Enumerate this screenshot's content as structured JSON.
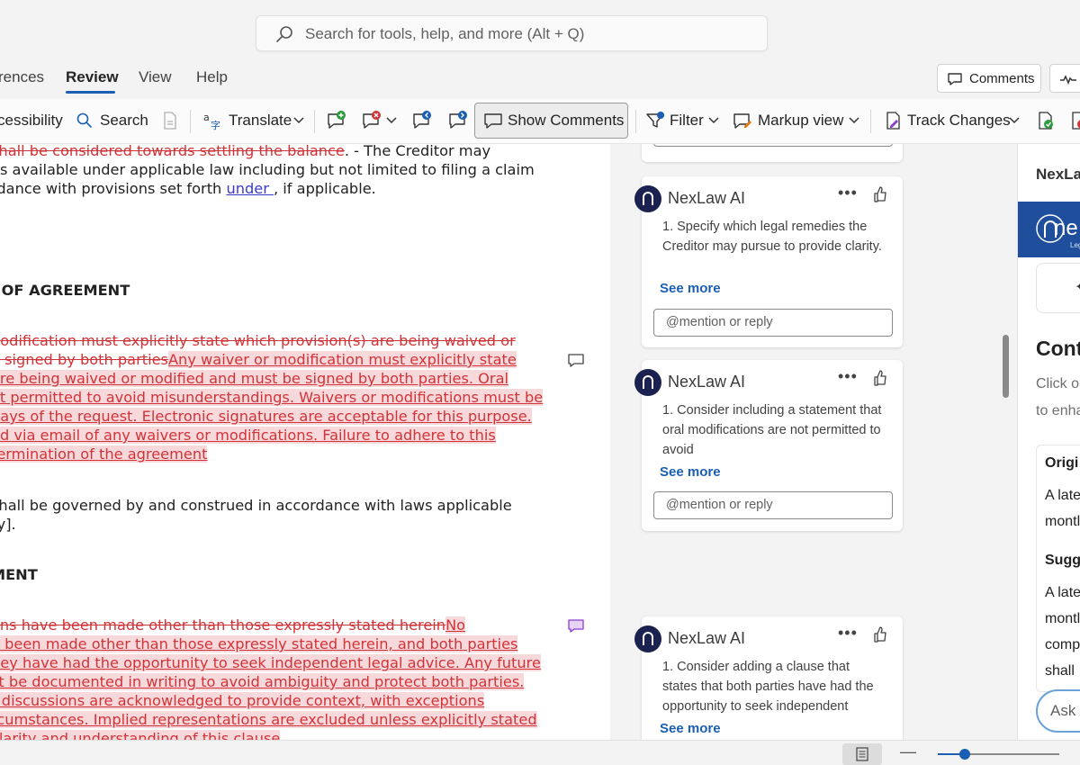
{
  "search": {
    "placeholder": "Search for tools, help, and more (Alt + Q)"
  },
  "tabs": {
    "references": "rences",
    "review": "Review",
    "view": "View",
    "help": "Help",
    "comments_button": "Comments"
  },
  "ribbon": {
    "accessibility": "cessibility",
    "search": "Search",
    "translate": "Translate",
    "show_comments": "Show Comments",
    "filter": "Filter",
    "markup_view": "Markup view",
    "track_changes": "Track Changes"
  },
  "document": {
    "l1_del": " shall be considered towards settling the balance",
    "l1_rest": ". - The Creditor may",
    "l2": "es available under applicable law including but not limited to filing a claim",
    "l3a": "rdance with provisions set forth ",
    "l3_ins": "under ",
    "l3b": ", if applicable.",
    "heading1": "I OF AGREEMENT",
    "p1_del1": "nodification must explicitly state which provision(s) are being waived or",
    "p1_del2": "e signed by both parties",
    "p1_ins1": "Any waiver or modification must explicitly state",
    "p1_ins2": "are being waived or modified and must be signed by both parties. Oral",
    "p1_ins3": "ot permitted to avoid misunderstandings. Waivers or modifications must be",
    "p1_ins4": "days of the request. Electronic signatures are acceptable for this purpose.",
    "p1_ins5": "ed via email of any waivers or modifications. Failure to adhere to this",
    "p1_ins6": " termination of the agreement",
    "g1": " shall be governed by and construed in accordance with laws applicable",
    "g2": "ry].",
    "heading2": "MENT",
    "p2_del1": "ons have been made other than those expressly stated herein",
    "p2_ins1": "No",
    "p2_ins2": "e been made other than those expressly stated herein, and both parties",
    "p2_ins3": "ney have had the opportunity to seek independent legal advice. Any future",
    "p2_ins4": "st be documented in writing to avoid ambiguity and protect both parties.",
    "p2_ins5": "r discussions are acknowledged to provide context, with exceptions",
    "p2_ins6": "rcumstances. Implied representations are excluded unless explicitly stated",
    "p2_ins7": " clarity and understanding of this clause"
  },
  "comments": [
    {
      "author": "NexLaw AI",
      "text": "1. Specify which legal remedies the Creditor may pursue to provide clarity.",
      "see_more": "See more",
      "reply_placeholder": "@mention or reply"
    },
    {
      "author": "NexLaw AI",
      "text": "1. Consider including a statement that oral modifications are not permitted to avoid",
      "see_more": "See more",
      "reply_placeholder": "@mention or reply"
    },
    {
      "author": "NexLaw AI",
      "text": "1. Consider adding a clause that states that both parties have had the opportunity to seek independent",
      "see_more": "See more"
    }
  ],
  "addin": {
    "title": "NexLa",
    "logo_text": "ne",
    "logo_small": "Leg",
    "heading": "Cont",
    "muted1": "Click o",
    "muted2": "to enha",
    "original_label": "Origi",
    "original_line1": "A late",
    "original_line2": "montl",
    "suggested_label": "Sugg",
    "suggested_line1": "A late",
    "suggested_line2": "montl",
    "suggested_line3": "comp",
    "suggested_line4": "shall",
    "ask_placeholder": "Ask"
  },
  "colors": {
    "accent": "#1a5fb4",
    "revision_red": "#d13438",
    "insert_highlight": "#f7d9dc",
    "avatar": "#1b2250"
  }
}
